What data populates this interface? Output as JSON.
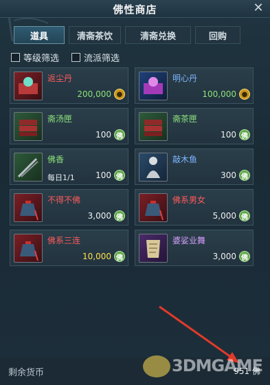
{
  "window": {
    "title": "佛性商店",
    "close_glyph": "✕"
  },
  "tabs": [
    {
      "label": "道具",
      "active": true
    },
    {
      "label": "清斋茶饮",
      "active": false
    },
    {
      "label": "清斋兑换",
      "active": false
    },
    {
      "label": "回购",
      "active": false
    }
  ],
  "filters": [
    {
      "label": "等级筛选",
      "checked": false
    },
    {
      "label": "流派筛选",
      "checked": false
    }
  ],
  "items": [
    {
      "name": "返尘丹",
      "price": "200,000",
      "currency": "coin",
      "price_color": "green",
      "name_color": "#ff5a5a",
      "icon": "red-pill-box-icon"
    },
    {
      "name": "明心丹",
      "price": "100,000",
      "currency": "coin",
      "price_color": "green",
      "name_color": "#7fb6ff",
      "icon": "purple-pill-box-icon"
    },
    {
      "name": "斋汤匣",
      "price": "100",
      "currency": "佛",
      "price_color": "white",
      "name_color": "#8ee27a",
      "icon": "book-box-icon"
    },
    {
      "name": "斋茶匣",
      "price": "100",
      "currency": "佛",
      "price_color": "white",
      "name_color": "#8ee27a",
      "icon": "book-box-icon"
    },
    {
      "name": "佛香",
      "sub": "每日1/1",
      "price": "100",
      "currency": "佛",
      "price_color": "white",
      "name_color": "#8ee27a",
      "icon": "incense-icon"
    },
    {
      "name": "敲木鱼",
      "price": "300",
      "currency": "佛",
      "price_color": "white",
      "name_color": "#7fb6ff",
      "icon": "monk-statue-icon"
    },
    {
      "name": "不得不佛",
      "price": "3,000",
      "currency": "佛",
      "price_color": "white",
      "name_color": "#ff5a5a",
      "icon": "charm-bag-icon"
    },
    {
      "name": "佛系男女",
      "price": "5,000",
      "currency": "佛",
      "price_color": "white",
      "name_color": "#ff5a5a",
      "icon": "charm-bag-icon"
    },
    {
      "name": "佛系三连",
      "price": "10,000",
      "currency": "佛",
      "price_color": "yellow",
      "name_color": "#ff5a5a",
      "icon": "charm-bag-icon"
    },
    {
      "name": "婆娑业舞",
      "price": "3,000",
      "currency": "佛",
      "price_color": "white",
      "name_color": "#d8a0ff",
      "icon": "dance-scroll-icon"
    }
  ],
  "footer": {
    "remaining_label": "剩余货币",
    "balance": "951",
    "balance_currency": "佛"
  },
  "watermark": {
    "text": "3DMGAME"
  },
  "colors": {
    "accent": "#2f5b72",
    "panel": "#22333f",
    "arrow": "#e23a2a"
  }
}
